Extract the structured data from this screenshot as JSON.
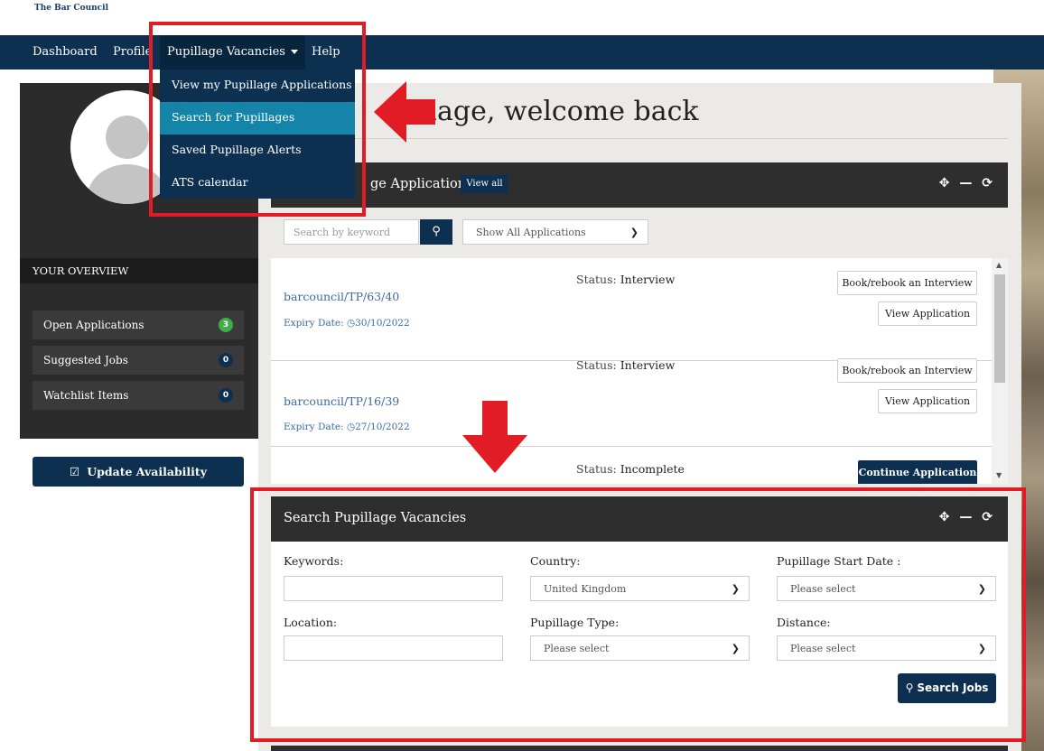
{
  "brand": {
    "name": "The Bar Council"
  },
  "nav": {
    "items": [
      {
        "label": "Dashboard"
      },
      {
        "label": "Profile"
      },
      {
        "label": "Pupillage Vacancies"
      },
      {
        "label": "Help"
      }
    ],
    "dropdown": [
      {
        "label": "View my Pupillage Applications"
      },
      {
        "label": "Search for Pupillages"
      },
      {
        "label": "Saved Pupillage Alerts"
      },
      {
        "label": "ATS calendar"
      }
    ]
  },
  "welcome": {
    "text": "pillage, welcome back"
  },
  "sidebar": {
    "overview_title": "YOUR OVERVIEW",
    "items": [
      {
        "label": "Open Applications",
        "count": "3"
      },
      {
        "label": "Suggested Jobs",
        "count": "0"
      },
      {
        "label": "Watchlist Items",
        "count": "0"
      }
    ],
    "update_button": "Update Availability"
  },
  "applications": {
    "title": "ge Applications",
    "view_all": "View all",
    "search_placeholder": "Search by keyword",
    "filter_value": "Show All Applications",
    "status_label": "Status:",
    "expiry_label": "Expiry Date:",
    "rows": [
      {
        "status": "Interview",
        "ref": "barcouncil/TP/63/40",
        "expiry": "30/10/2022",
        "btn1": "Book/rebook an Interview",
        "btn2": "View Application"
      },
      {
        "status": "Interview",
        "ref": "barcouncil/TP/16/39",
        "expiry": "27/10/2022",
        "btn1": "Book/rebook an Interview",
        "btn2": "View Application"
      },
      {
        "status": "Incomplete",
        "btn1": "Continue Application"
      }
    ]
  },
  "search_panel": {
    "title": "Search Pupillage Vacancies",
    "keywords_label": "Keywords:",
    "country_label": "Country:",
    "country_value": "United Kingdom",
    "start_date_label": "Pupillage Start Date :",
    "start_date_value": "Please select",
    "location_label": "Location:",
    "type_label": "Pupillage Type:",
    "type_value": "Please select",
    "distance_label": "Distance:",
    "distance_value": "Please select",
    "search_button": "Search Jobs"
  },
  "colors": {
    "navy": "#0d3050",
    "highlight": "#1484a8",
    "annotation_red": "#e11c24",
    "badge_green": "#3fae49"
  }
}
